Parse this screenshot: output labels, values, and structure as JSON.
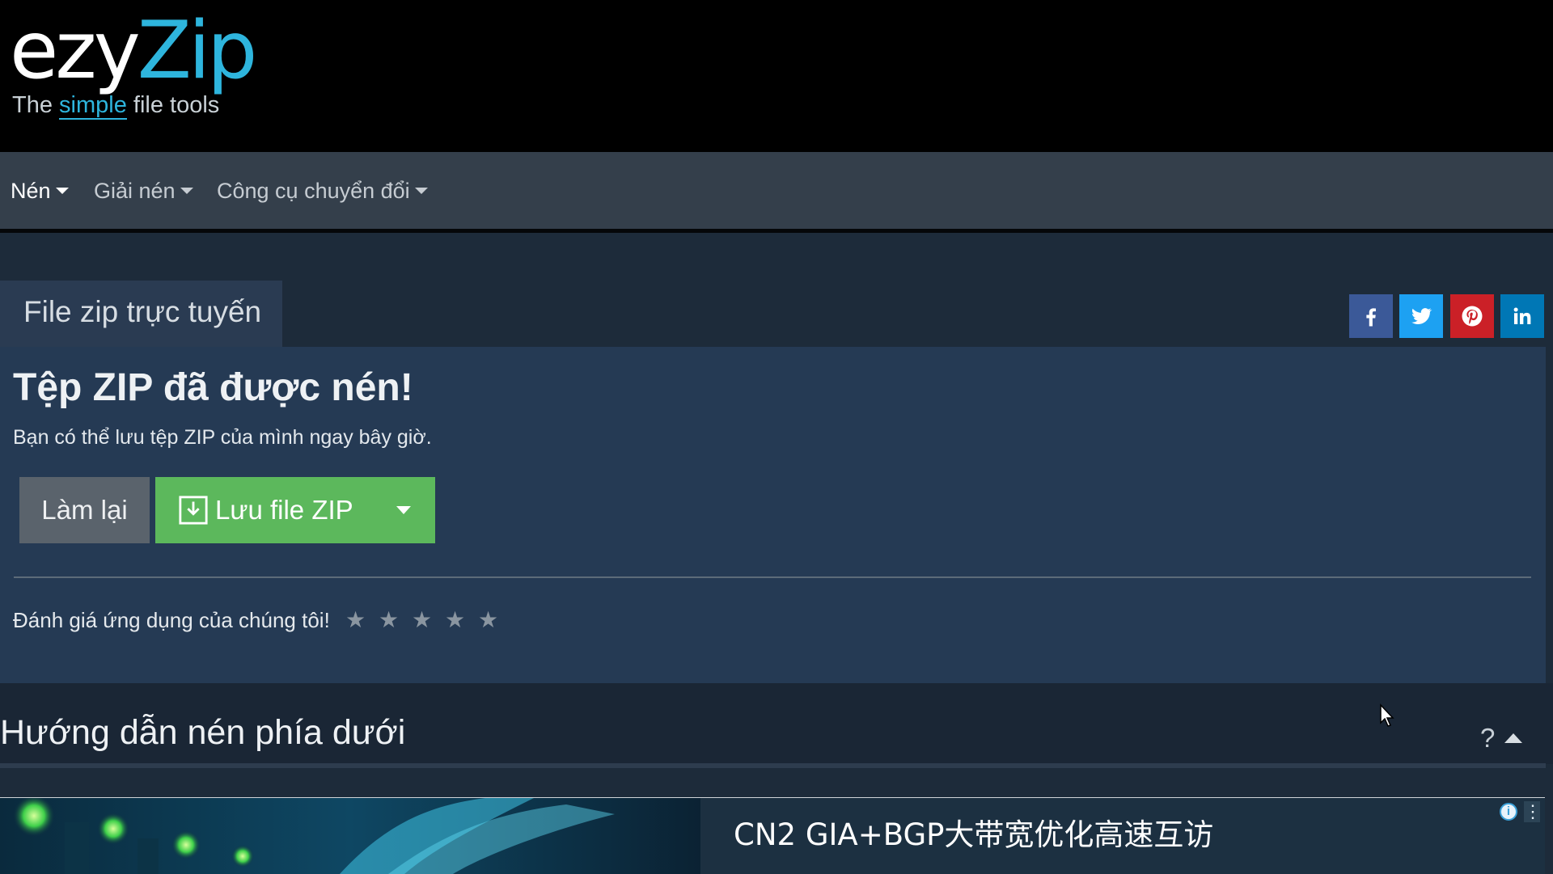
{
  "logo": {
    "part1": "ezy",
    "part2": "Zip",
    "tagline_pre": "The",
    "tagline_em": "simple",
    "tagline_post": "file tools",
    "accent": "#2eb5dd"
  },
  "nav": {
    "items": [
      {
        "label": "Nén",
        "active": true
      },
      {
        "label": "Giải nén",
        "active": false
      },
      {
        "label": "Công cụ chuyển đổi",
        "active": false
      }
    ]
  },
  "tab": {
    "label": "File zip trực tuyến"
  },
  "share": {
    "icons": [
      "facebook-icon",
      "twitter-icon",
      "pinterest-icon",
      "linkedin-icon"
    ],
    "colors": [
      "#3b5998",
      "#1da1f2",
      "#cb2027",
      "#0077b5"
    ]
  },
  "result": {
    "heading": "Tệp ZIP đã được nén!",
    "subtext": "Bạn có thể lưu tệp ZIP của mình ngay bây giờ.",
    "redo_label": "Làm lại",
    "save_label": "Lưu file ZIP",
    "save_color": "#5cb85c"
  },
  "rating": {
    "label": "Đánh giá ứng dụng của chúng tôi!",
    "max_stars": 5,
    "selected": 0,
    "star_glyph": "★"
  },
  "guide": {
    "title": "Hướng dẫn nén phía dưới",
    "help": "?"
  },
  "ad": {
    "text": "CN2 GIA+BGP大带宽优化高速互访",
    "info_glyph": "i",
    "menu_glyph": "⋮"
  }
}
